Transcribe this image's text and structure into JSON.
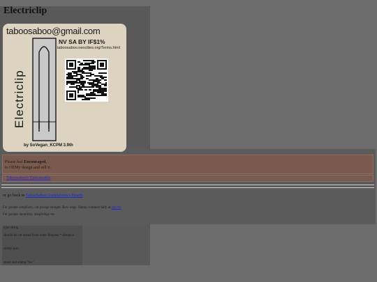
{
  "page": {
    "title": "Electriclip"
  },
  "card": {
    "email": "taboosaboo@gmail.com",
    "license": "NV SA BY IF$1%",
    "terms_url": "taboosaboo.neocities.org/Terms.html",
    "vertical_name": "Electriclip",
    "byline": "by SoVegan_KCPM  3.9th"
  },
  "info": {
    "line1_prefix": "Please feel ",
    "line1_bold": "Encouraged",
    "line1_suffix": ",",
    "line2": "to OEMy design and sell it."
  },
  "catalog_link": "Taboosaboo's Endorseable",
  "goback": {
    "prefix": "or go back to ",
    "link": "TabooSaboo Undulations's Hearth"
  },
  "paragraphs": {
    "p1_text": "For greater simplicity, cut prongs straight. Bow edge. Stamp commercially at ",
    "p1_link": "atacdm",
    "p2": "For greater durability, deepbridge tm."
  },
  "notes": {
    "n1": "type string",
    "n2": "should be cut ahead from outer fineplus * distance",
    "n3": "stamp spec",
    "n4": "stand and stamp \"bw\""
  }
}
